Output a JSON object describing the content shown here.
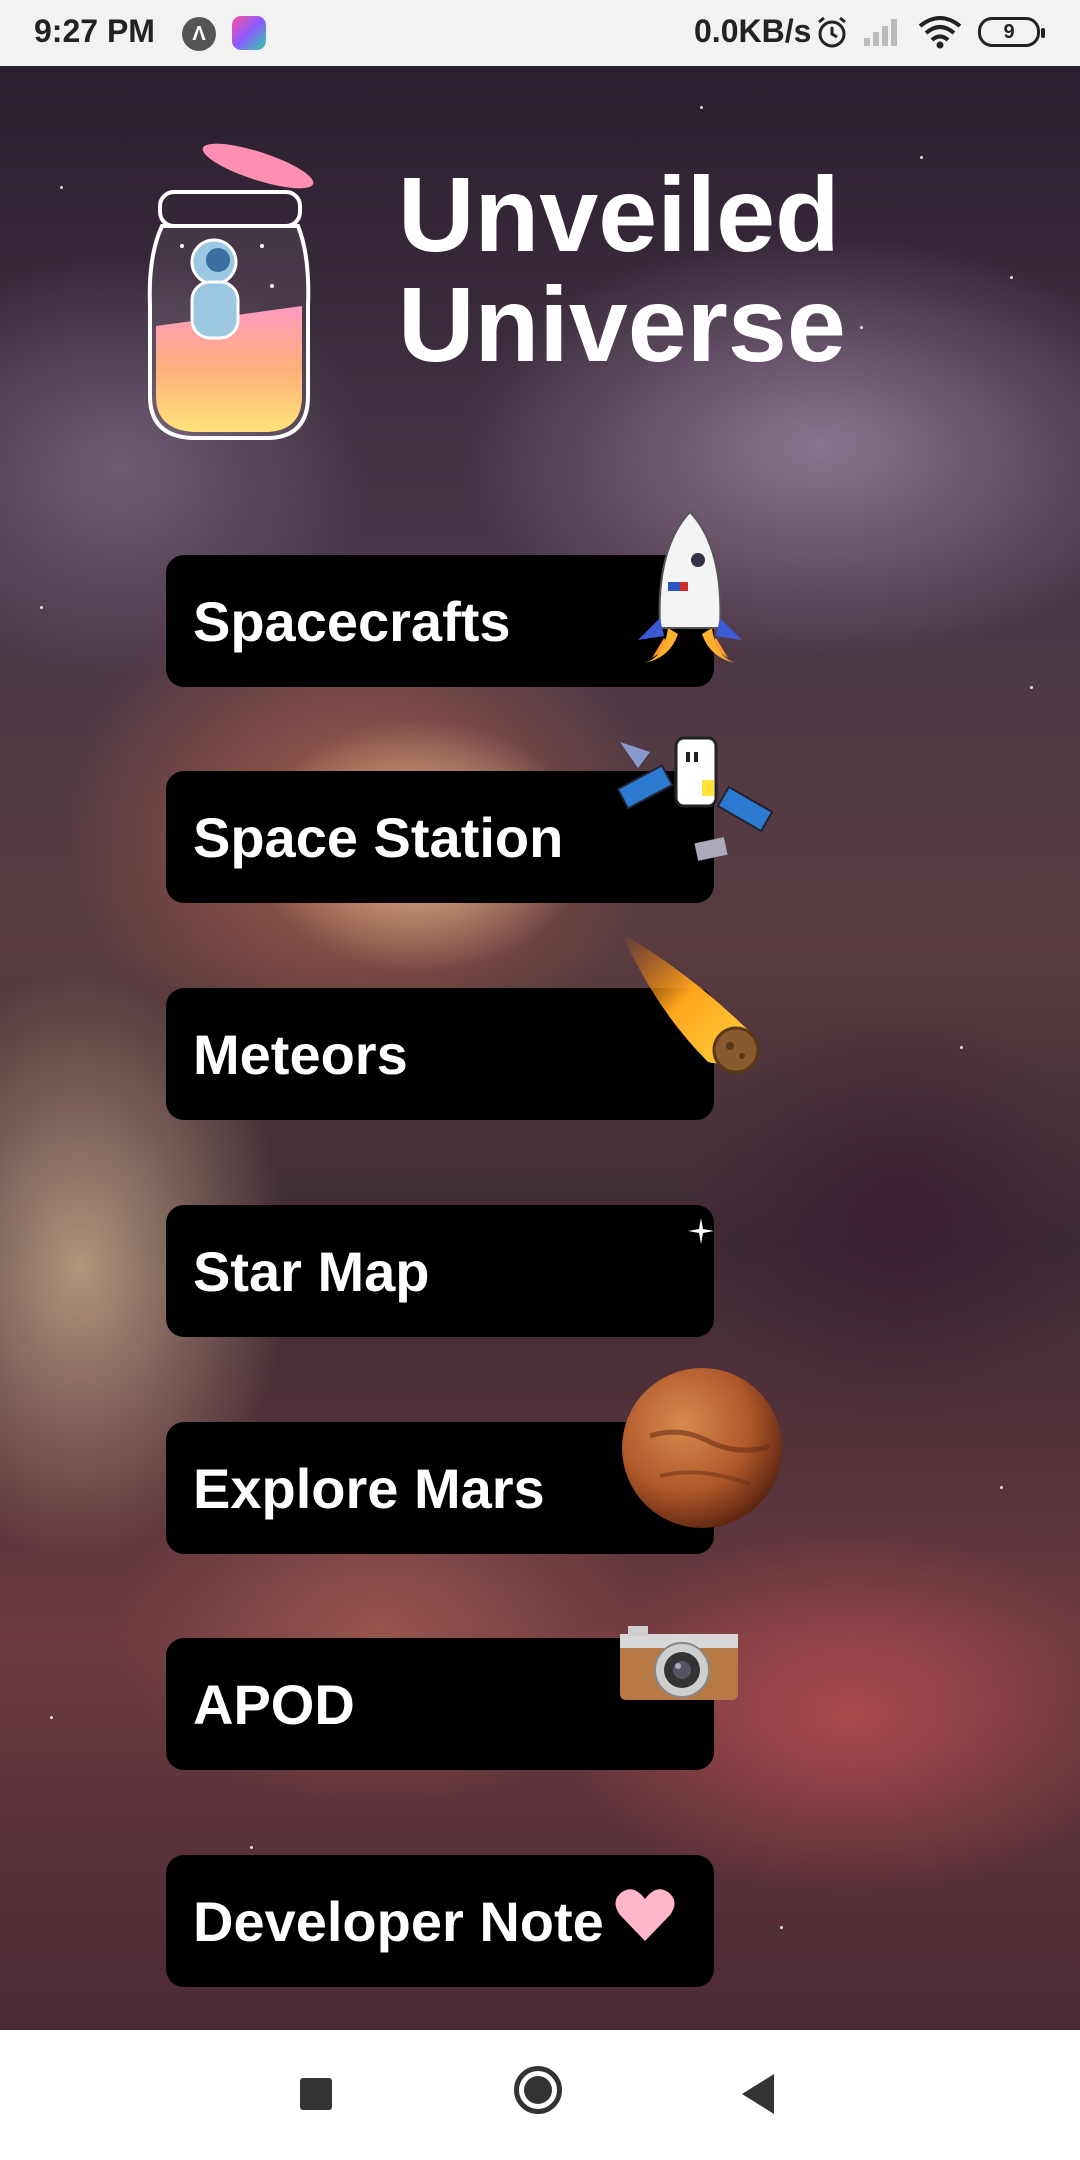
{
  "status_bar": {
    "time": "9:27 PM",
    "speed": "0.0KB/s",
    "battery": "9",
    "icons": [
      "app-a-icon",
      "app-b-icon",
      "alarm-icon",
      "signal-icon",
      "wifi-icon",
      "battery-icon"
    ]
  },
  "header": {
    "title_line1": "Unveiled",
    "title_line2": "Universe",
    "logo_icon": "astronaut-jar-icon"
  },
  "menu": {
    "items": [
      {
        "label": "Spacecrafts",
        "icon": "rocket-icon"
      },
      {
        "label": "Space Station",
        "icon": "satellite-icon"
      },
      {
        "label": "Meteors",
        "icon": "meteor-icon"
      },
      {
        "label": "Star Map",
        "icon": "sparkle-star-icon"
      },
      {
        "label": "Explore Mars",
        "icon": "mars-planet-icon"
      },
      {
        "label": "APOD",
        "icon": "camera-icon"
      },
      {
        "label": "Developer Note",
        "icon": "heart-icon"
      }
    ]
  },
  "nav_bar": {
    "icons": [
      "recents-square-icon",
      "home-circle-icon",
      "back-triangle-icon"
    ]
  },
  "colors": {
    "button_bg": "#000000",
    "button_text": "#ffffff",
    "title_text": "#ffffff",
    "status_bar_bg": "#f2f2f2",
    "nav_bar_bg": "#ffffff",
    "heart": "#ffb6c8"
  }
}
